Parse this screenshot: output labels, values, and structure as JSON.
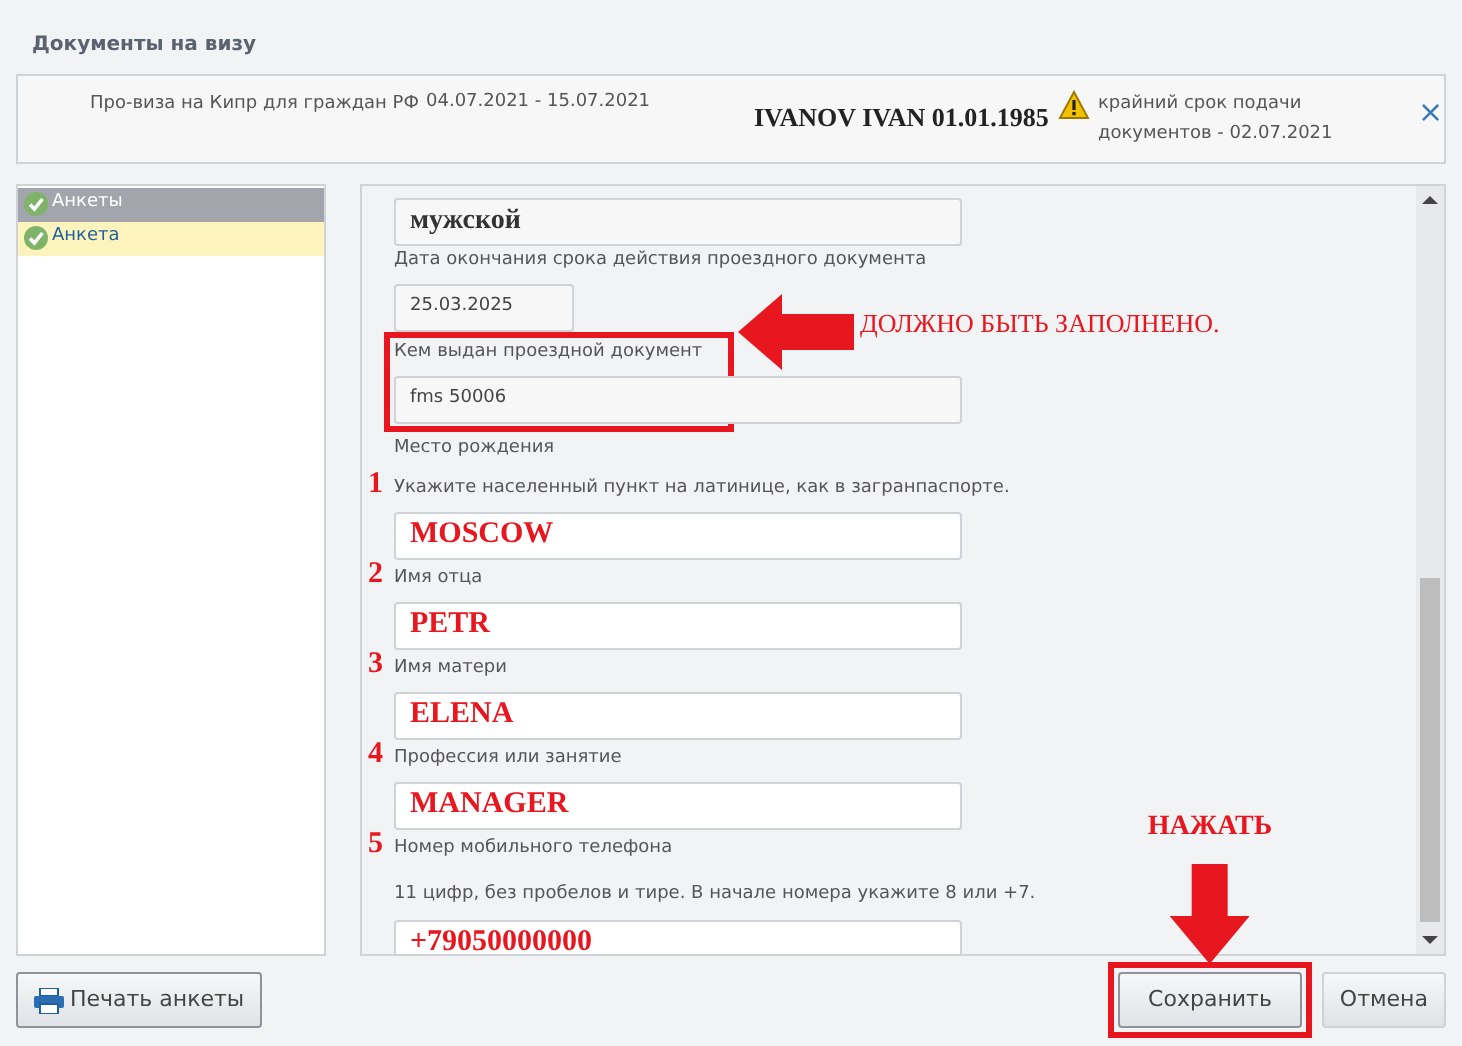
{
  "dialog": {
    "title": "Документы на визу"
  },
  "info": {
    "program": "Про-виза на Кипр для граждан РФ",
    "dates": "04.07.2021 - 15.07.2021",
    "applicant": "IVANOV IVAN 01.01.1985",
    "deadline": "крайний срок подачи документов - 02.07.2021",
    "close": "×"
  },
  "sidebar": {
    "items": [
      {
        "label": "Анкеты",
        "kind": "header",
        "checked": true,
        "selected": false
      },
      {
        "label": "Анкета",
        "kind": "item",
        "checked": true,
        "selected": true
      }
    ]
  },
  "form": {
    "items": [
      {
        "kind": "select",
        "value": "мужской"
      },
      {
        "kind": "label",
        "text": "Дата окончания срока действия проездного документа"
      },
      {
        "kind": "date",
        "value": "25.03.2025"
      },
      {
        "kind": "label",
        "text": "Кем выдан проездной документ",
        "highlighted": true
      },
      {
        "kind": "readonly",
        "value": "fms 50006",
        "highlighted": true
      },
      {
        "kind": "label",
        "text": "Место рождения"
      },
      {
        "kind": "label",
        "number": "1",
        "text": "Укажите населенный пункт на латинице, как в загранпаспорте."
      },
      {
        "kind": "entry",
        "value": "MOSCOW"
      },
      {
        "kind": "label",
        "number": "2",
        "text": "Имя отца"
      },
      {
        "kind": "entry",
        "value": "PETR"
      },
      {
        "kind": "label",
        "number": "3",
        "text": "Имя матери"
      },
      {
        "kind": "entry",
        "value": "ELENA"
      },
      {
        "kind": "label",
        "number": "4",
        "text": "Профессия или занятие"
      },
      {
        "kind": "entry",
        "value": "MANAGER"
      },
      {
        "kind": "label",
        "number": "5",
        "text": "Номер мобильного телефона"
      },
      {
        "kind": "hint",
        "text": "11 цифр, без пробелов и тире. В начале номера укажите 8 или +7."
      },
      {
        "kind": "entry",
        "value": "+79050000000"
      }
    ],
    "callout": "ДОЛЖНО БЫТЬ ЗАПОЛНЕНО."
  },
  "footer": {
    "print": "Печать анкеты",
    "save": {
      "label": "Сохранить",
      "highlighted": true,
      "callout": "НАЖАТЬ"
    },
    "cancel": "Отмена"
  }
}
